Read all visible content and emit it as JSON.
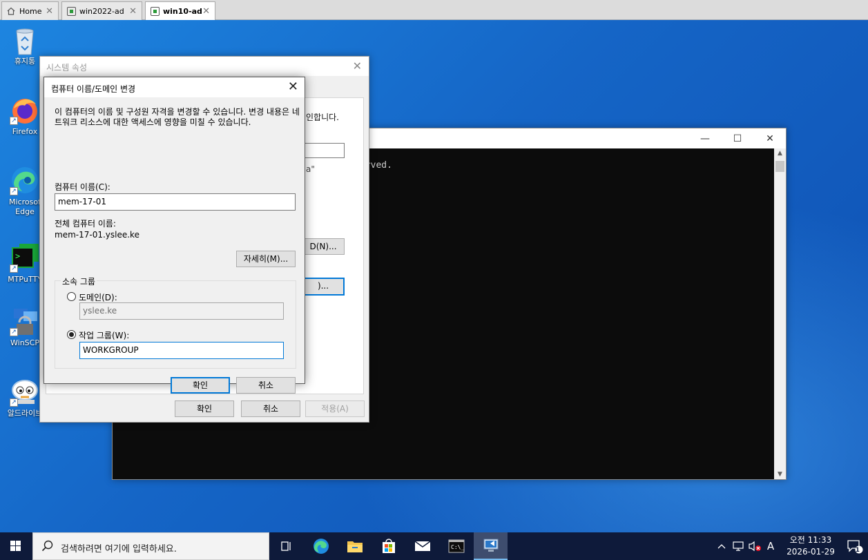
{
  "tabs": [
    {
      "label": "Home",
      "icon": "home-icon"
    },
    {
      "label": "win2022-ad",
      "icon": "vm-icon"
    },
    {
      "label": "win10-ad",
      "icon": "vm-icon",
      "active": true
    }
  ],
  "desktop_icons": [
    {
      "label": "휴지통",
      "icon": "recycle-bin-icon"
    },
    {
      "label": "Firefox",
      "icon": "firefox-icon"
    },
    {
      "label": "Microsoft Edge",
      "label_l1": "Microsof",
      "label_l2": "Edge",
      "icon": "edge-icon"
    },
    {
      "label": "MTPuTTY",
      "icon": "mtputty-icon"
    },
    {
      "label": "WinSCP",
      "icon": "winscp-icon"
    },
    {
      "label": "알드라이브",
      "icon": "aldrive-icon"
    }
  ],
  "cmd_window": {
    "visible_text": "erved.",
    "min": "—",
    "max": "☐",
    "close": "✕"
  },
  "system_properties": {
    "title": "시스템 속성",
    "close": "✕",
    "fragment_text": "인합니다.",
    "fragment_quote": "a\"",
    "btn_network_id": "D(N)...",
    "btn_change": ")...",
    "ok": "확인",
    "cancel": "취소",
    "apply": "적용(A)"
  },
  "computer_name_dialog": {
    "title": "컴퓨터 이름/도메인 변경",
    "close": "✕",
    "description": "이 컴퓨터의 이름 및 구성원 자격을 변경할 수 있습니다. 변경 내용은 네트워크 리소스에 대한 액세스에 영향을 미칠 수 있습니다.",
    "computer_name_label": "컴퓨터 이름(C):",
    "computer_name_value": "mem-17-01",
    "full_name_label": "전체 컴퓨터 이름:",
    "full_name_value": "mem-17-01.yslee.ke",
    "more_button": "자세히(M)...",
    "member_of_label": "소속 그룹",
    "domain_label": "도메인(D):",
    "domain_value": "yslee.ke",
    "workgroup_label": "작업 그룹(W):",
    "workgroup_value": "WORKGROUP",
    "selected_membership": "workgroup",
    "ok": "확인",
    "cancel": "취소"
  },
  "taskbar": {
    "search_placeholder": "검색하려면 여기에 입력하세요.",
    "apps": [
      "task-view-icon",
      "edge-icon",
      "file-explorer-icon",
      "store-icon",
      "mail-icon",
      "terminal-icon",
      "remote-desktop-icon"
    ],
    "active_app": "remote-desktop-icon",
    "tray": {
      "ime": "A",
      "time": "오전 11:33",
      "date": "2026-01-29",
      "notification_count": "1"
    }
  }
}
